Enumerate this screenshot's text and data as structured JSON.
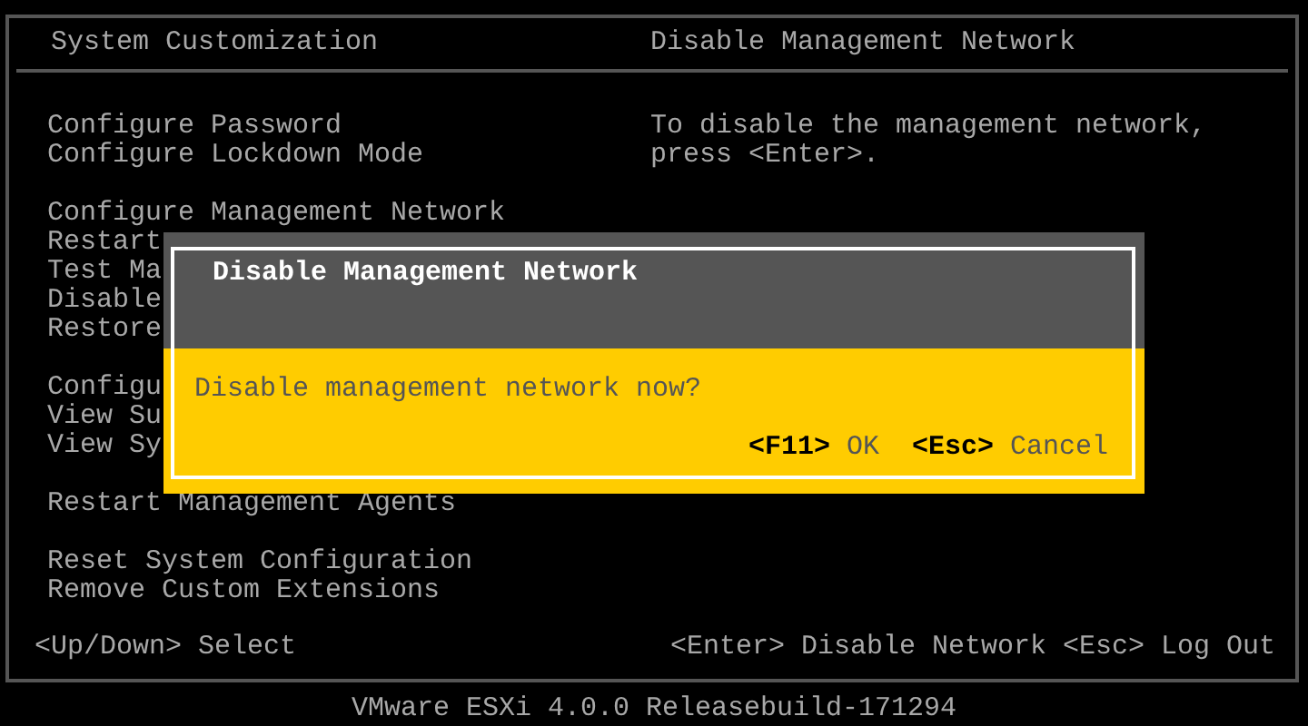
{
  "header": {
    "left_title": "System Customization",
    "right_title": "Disable Management Network"
  },
  "menu_groups": [
    {
      "items": [
        "Configure Password",
        "Configure Lockdown Mode"
      ]
    },
    {
      "items": [
        "Configure Management Network",
        "Restart",
        "Test Ma",
        "Disable",
        "Restore"
      ]
    },
    {
      "items": [
        "Configu",
        "View Su",
        "View Sy"
      ]
    },
    {
      "items": [
        "Restart Management Agents"
      ]
    },
    {
      "items": [
        "Reset System Configuration",
        "Remove Custom Extensions"
      ]
    }
  ],
  "description": "To disable the management network, press <Enter>.",
  "footer": {
    "left": "<Up/Down> Select",
    "right": "<Enter> Disable Network <Esc> Log Out"
  },
  "version": "VMware ESXi 4.0.0 Releasebuild-171294",
  "dialog": {
    "title": "Disable Management Network",
    "message": "Disable management network now?",
    "actions": [
      {
        "key": "<F11>",
        "label": "OK"
      },
      {
        "key": "<Esc>",
        "label": "Cancel"
      }
    ]
  }
}
